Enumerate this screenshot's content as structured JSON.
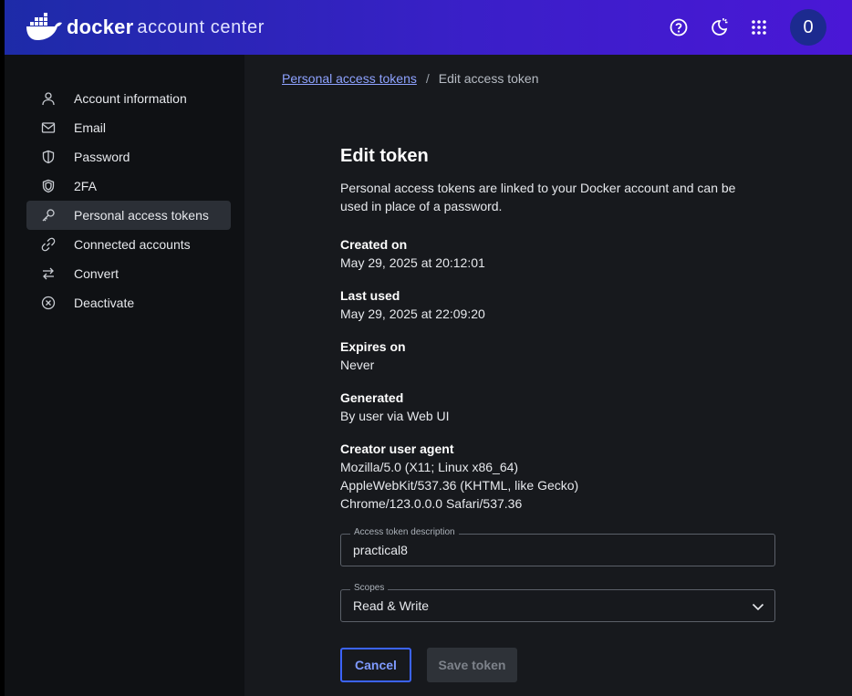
{
  "header": {
    "brand_name": "docker",
    "brand_subtitle": "account center",
    "avatar_letter": "0",
    "icons": [
      "help-icon",
      "theme-toggle-icon",
      "apps-grid-icon"
    ]
  },
  "sidebar": {
    "items": [
      {
        "label": "Account information",
        "icon": "user-icon"
      },
      {
        "label": "Email",
        "icon": "mail-icon"
      },
      {
        "label": "Password",
        "icon": "shield-icon"
      },
      {
        "label": "2FA",
        "icon": "double-shield-icon"
      },
      {
        "label": "Personal access tokens",
        "icon": "key-icon",
        "active": true
      },
      {
        "label": "Connected accounts",
        "icon": "link-icon"
      },
      {
        "label": "Convert",
        "icon": "swap-icon"
      },
      {
        "label": "Deactivate",
        "icon": "cancel-circle-icon"
      }
    ]
  },
  "breadcrumb": {
    "parent": "Personal access tokens",
    "separator": "/",
    "current": "Edit access token"
  },
  "form": {
    "title": "Edit token",
    "description": "Personal access tokens are linked to your Docker account and can be used in place of a password.",
    "created_label": "Created on",
    "created_value": "May 29, 2025 at 20:12:01",
    "last_used_label": "Last used",
    "last_used_value": "May 29, 2025 at 22:09:20",
    "expires_label": "Expires on",
    "expires_value": "Never",
    "generated_label": "Generated",
    "generated_value": "By user via Web UI",
    "agent_label": "Creator user agent",
    "agent_line1": "Mozilla/5.0 (X11; Linux x86_64)",
    "agent_line2": "AppleWebKit/537.36 (KHTML, like Gecko)",
    "agent_line3": "Chrome/123.0.0.0 Safari/537.36",
    "description_field_label": "Access token description",
    "description_field_value": "practical8",
    "scopes_label": "Scopes",
    "scopes_value": "Read & Write",
    "cancel_label": "Cancel",
    "save_label": "Save token"
  },
  "colors": {
    "header_gradient_start": "#1d2ba8",
    "header_gradient_end": "#4a17d6",
    "accent": "#3b63ff",
    "link": "#8ea2ff"
  }
}
